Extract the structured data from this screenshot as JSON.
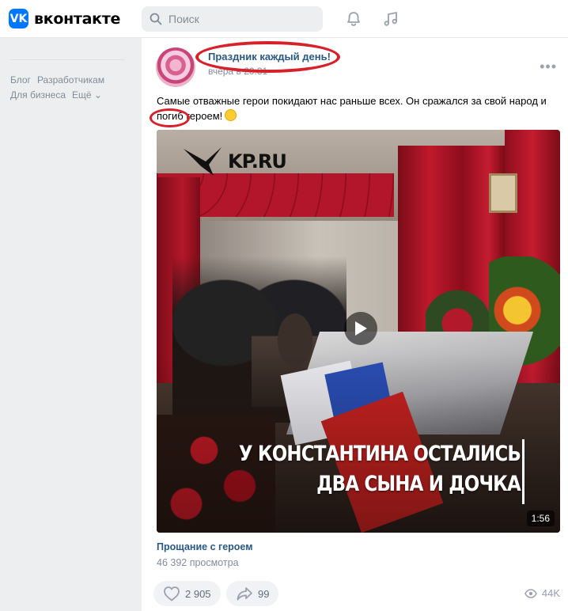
{
  "header": {
    "logo_text": "вконтакте",
    "logo_mark": "VK",
    "search_placeholder": "Поиск",
    "icons": [
      "vk-logo-icon",
      "search-icon",
      "bell-icon",
      "music-note-icon"
    ]
  },
  "sidebar": {
    "footer_links": [
      "Блог",
      "Разработчикам",
      "Для бизнеса",
      "Ещё ⌄"
    ]
  },
  "post": {
    "author": "Праздник каждый день!",
    "date": "вчера в 20:31",
    "text_before": "Самые отважные герои покидают нас раньше всех. Он сражался за свой народ и ",
    "text_highlight": "погиб",
    "text_after": " героем!",
    "more_icon": "more-dots-icon",
    "annotations_color": "#d7202a",
    "video": {
      "brand": "KP.RU",
      "caption_line1": "У КОНСТАНТИНА ОСТАЛИСЬ",
      "caption_line2": "ДВА СЫНА И ДОЧКА",
      "duration": "1:56",
      "title": "Прощание с героем",
      "views_text": "46 392 просмотра"
    },
    "likes": "2 905",
    "shares": "99",
    "views": "44K"
  },
  "colors": {
    "accent": "#0077ff",
    "link": "#2a5885",
    "muted": "#818c99",
    "page_bg": "#edeef0"
  }
}
